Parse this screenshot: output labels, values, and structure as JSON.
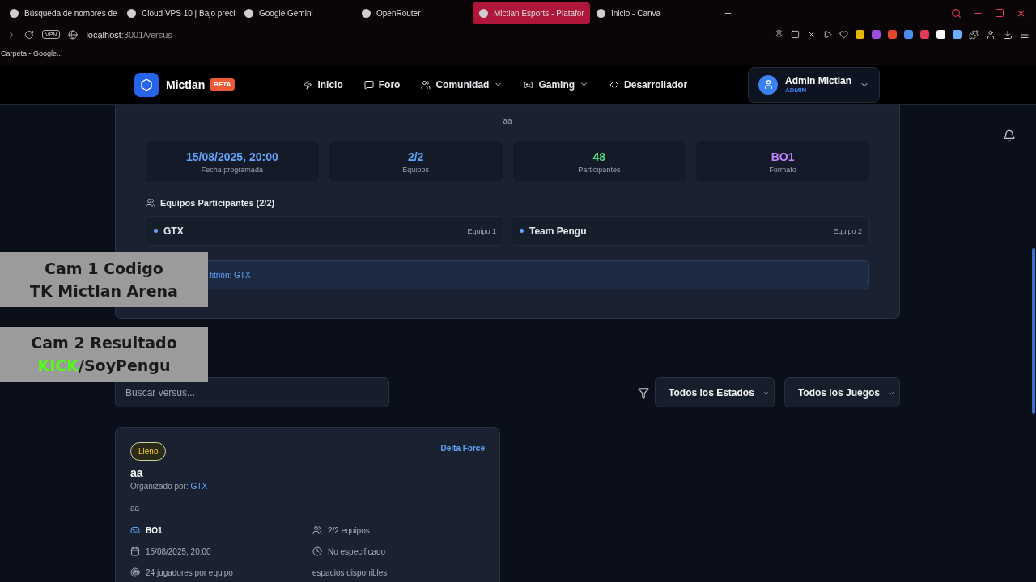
{
  "browser": {
    "tabs": [
      {
        "label": "Búsqueda de nombres de",
        "selected": false
      },
      {
        "label": "Cloud VPS 10 | Bajo preci",
        "selected": false
      },
      {
        "label": "Google Gemini",
        "selected": false
      },
      {
        "label": "OpenRouter",
        "selected": false
      },
      {
        "label": "Mictlan Esports - Platafor",
        "selected": true
      },
      {
        "label": "Inicio - Canva",
        "selected": false
      }
    ],
    "vpn": "VPN",
    "address": {
      "host": "localhost",
      "path": ":3001/versus"
    },
    "bookmarks": [
      "Carpeta - Google..."
    ]
  },
  "header": {
    "logo": "Mictlan",
    "badge": "BETA",
    "nav": [
      {
        "label": "Inicio",
        "kind": "link"
      },
      {
        "label": "Foro",
        "kind": "link"
      },
      {
        "label": "Comunidad",
        "kind": "dropdown"
      },
      {
        "label": "Gaming",
        "kind": "dropdown"
      },
      {
        "label": "Desarrollador",
        "kind": "link"
      }
    ],
    "user": {
      "name": "Admin Mictlan",
      "role": "ADMIN"
    }
  },
  "versus_detail": {
    "description": "aa",
    "stats": [
      {
        "value": "15/08/2025, 20:00",
        "label": "Fecha programada",
        "color": "#60a5fa"
      },
      {
        "value": "2/2",
        "label": "Equipos",
        "color": "#60a5fa"
      },
      {
        "value": "48",
        "label": "Participantes",
        "color": "#4ade80"
      },
      {
        "value": "BO1",
        "label": "Formato",
        "color": "#c084fc"
      }
    ],
    "teams_heading": "Equipos Participantes (2/2)",
    "teams": [
      {
        "name": "GTX",
        "slot": "Equipo 1"
      },
      {
        "name": "Team Pengu",
        "slot": "Equipo 2"
      }
    ],
    "host_note": "fitrión: GTX"
  },
  "filters": {
    "search": {
      "placeholder": "Buscar versus..."
    },
    "selects": [
      "Todos los Estados",
      "Todos los Juegos"
    ]
  },
  "listing": {
    "status": "Lleno",
    "game": "Delta Force",
    "title": "aa",
    "organizer_label": "Organizado por:",
    "organizer": "GTX",
    "description": "aa",
    "details": [
      {
        "kind": "format",
        "text": "BO1"
      },
      {
        "kind": "teams",
        "text": "2/2 equipos"
      },
      {
        "kind": "date",
        "text": "15/08/2025, 20:00"
      },
      {
        "kind": "time",
        "text": "No especificado"
      },
      {
        "kind": "players",
        "text": "24 jugadores por equipo"
      },
      {
        "kind": "plain",
        "text": "espacios disponibles"
      }
    ]
  },
  "overlays": [
    {
      "lines": [
        [
          {
            "text": "Cam 1 Codigo",
            "color": "#1a1a1a"
          }
        ],
        [
          {
            "text": "TK Mictlan Arena",
            "color": "#1a1a1a"
          }
        ]
      ]
    },
    {
      "lines": [
        [
          {
            "text": "Cam 2 Resultado",
            "color": "#1a1a1a"
          }
        ],
        [
          {
            "text": "KICK",
            "color": "#53fc18"
          },
          {
            "text": "/SoyPengu",
            "color": "#1a1a1a"
          }
        ]
      ]
    }
  ]
}
